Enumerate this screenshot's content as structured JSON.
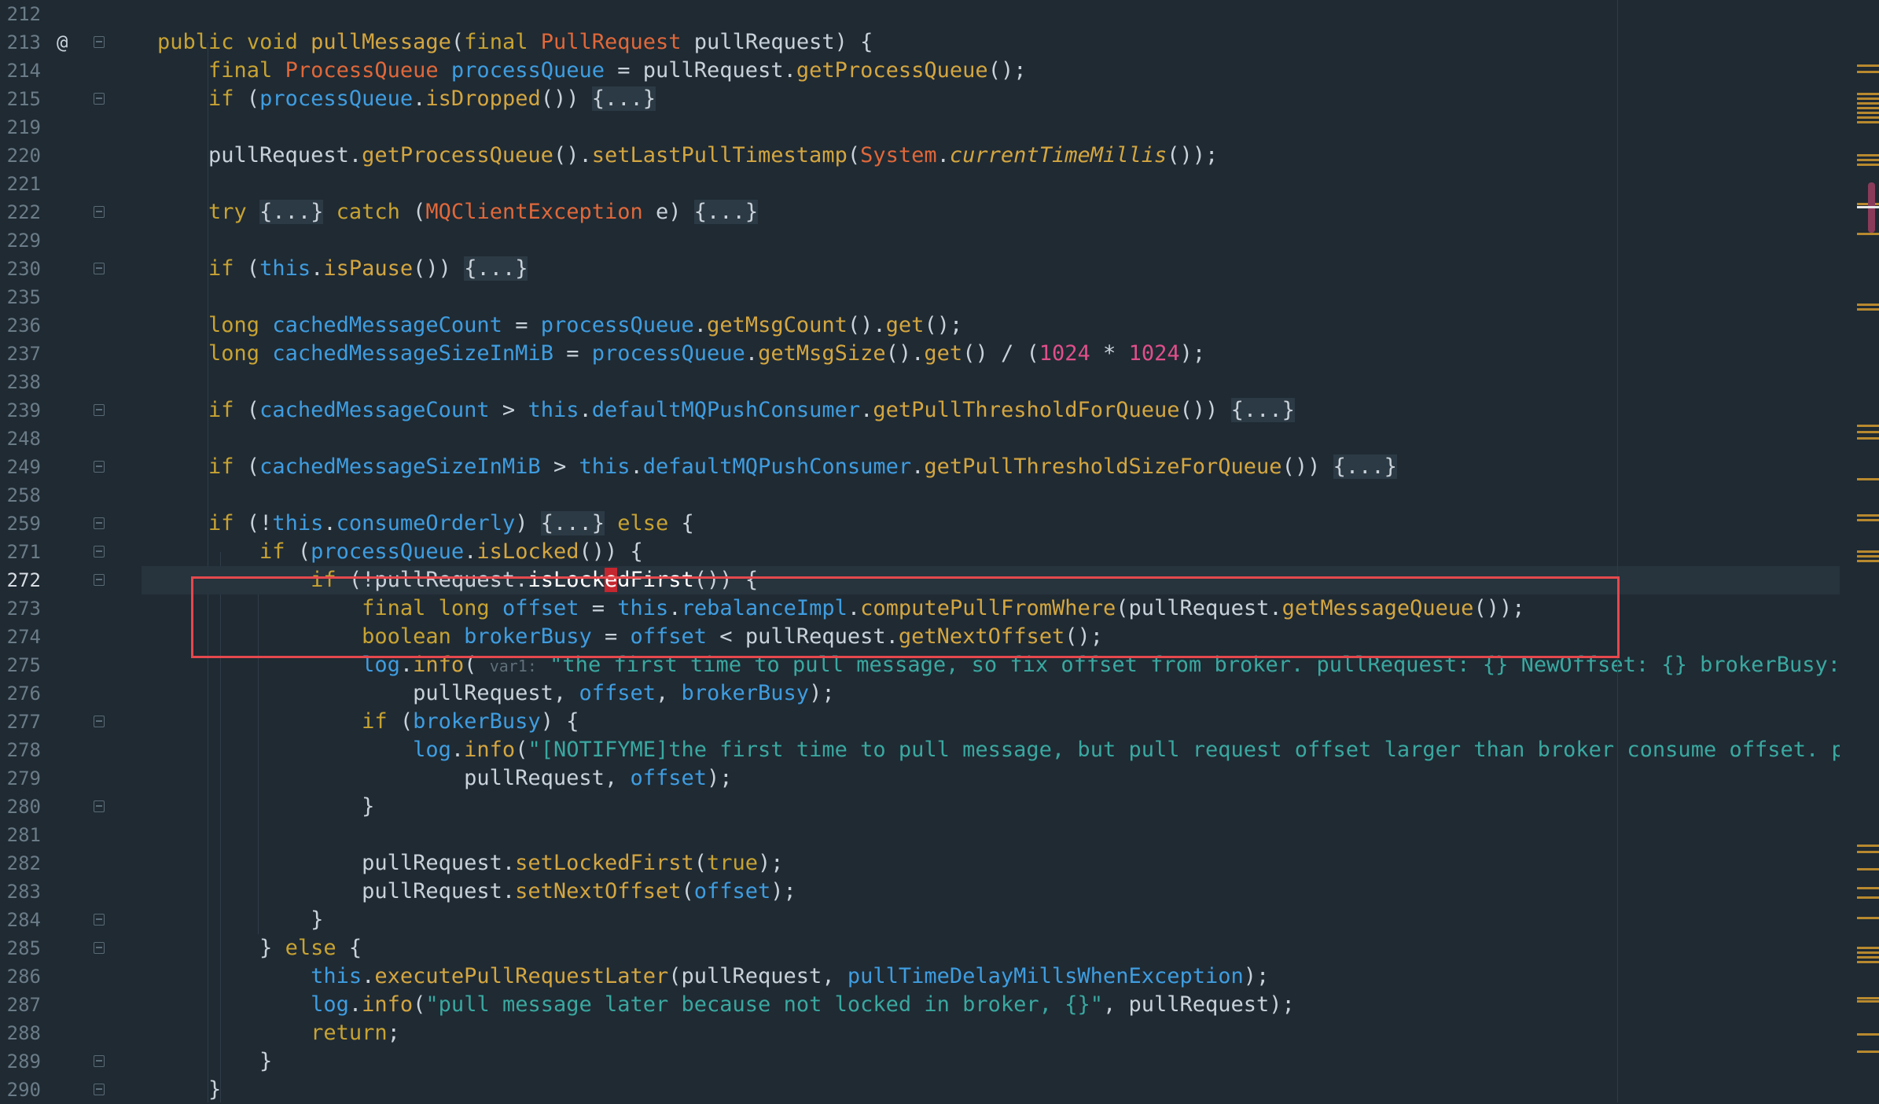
{
  "editor": {
    "colors": {
      "background": "#1f2a33",
      "keyword": "#c8a332",
      "type": "#e0683a",
      "field": "#3f9de0",
      "method": "#d4a640",
      "string": "#3aa8a0",
      "number": "#e04f8a",
      "default": "#c9d1d9",
      "fold": "#3a4a56",
      "highlight_box": "#e5484d"
    },
    "gutter_icons": {
      "override": "@"
    },
    "fold_icon_name": "fold-icon",
    "current_line": "272",
    "lines": [
      {
        "num": "212",
        "fold": false,
        "tokens": []
      },
      {
        "num": "213",
        "fold": true,
        "icon": "override",
        "tokens": [
          [
            "k",
            "public"
          ],
          [
            "d",
            " "
          ],
          [
            "k",
            "void"
          ],
          [
            "d",
            " "
          ],
          [
            "m",
            "pullMessage"
          ],
          [
            "d",
            "("
          ],
          [
            "k",
            "final"
          ],
          [
            "d",
            " "
          ],
          [
            "t",
            "PullRequest"
          ],
          [
            "d",
            " pullRequest) {"
          ]
        ]
      },
      {
        "num": "214",
        "fold": false,
        "tokens": [
          [
            "d",
            "    "
          ],
          [
            "k",
            "final"
          ],
          [
            "d",
            " "
          ],
          [
            "t",
            "ProcessQueue"
          ],
          [
            "d",
            " "
          ],
          [
            "f",
            "processQueue"
          ],
          [
            "d",
            " = pullRequest."
          ],
          [
            "m",
            "getProcessQueue"
          ],
          [
            "d",
            "();"
          ]
        ]
      },
      {
        "num": "215",
        "fold": true,
        "tokens": [
          [
            "d",
            "    "
          ],
          [
            "k",
            "if"
          ],
          [
            "d",
            " ("
          ],
          [
            "f",
            "processQueue"
          ],
          [
            "d",
            "."
          ],
          [
            "m",
            "isDropped"
          ],
          [
            "d",
            "()) "
          ],
          [
            "b",
            "{...}"
          ]
        ]
      },
      {
        "num": "219",
        "fold": false,
        "tokens": []
      },
      {
        "num": "220",
        "fold": false,
        "tokens": [
          [
            "d",
            "    pullRequest."
          ],
          [
            "m",
            "getProcessQueue"
          ],
          [
            "d",
            "()."
          ],
          [
            "m",
            "setLastPullTimestamp"
          ],
          [
            "d",
            "("
          ],
          [
            "t",
            "System"
          ],
          [
            "d",
            "."
          ],
          [
            "i",
            "currentTimeMillis"
          ],
          [
            "d",
            "());"
          ]
        ]
      },
      {
        "num": "221",
        "fold": false,
        "tokens": []
      },
      {
        "num": "222",
        "fold": true,
        "tokens": [
          [
            "d",
            "    "
          ],
          [
            "k",
            "try"
          ],
          [
            "d",
            " "
          ],
          [
            "b",
            "{...}"
          ],
          [
            "d",
            " "
          ],
          [
            "k",
            "catch"
          ],
          [
            "d",
            " ("
          ],
          [
            "t",
            "MQClientException"
          ],
          [
            "d",
            " e) "
          ],
          [
            "b",
            "{...}"
          ]
        ]
      },
      {
        "num": "229",
        "fold": false,
        "tokens": []
      },
      {
        "num": "230",
        "fold": true,
        "tokens": [
          [
            "d",
            "    "
          ],
          [
            "k",
            "if"
          ],
          [
            "d",
            " ("
          ],
          [
            "f",
            "this"
          ],
          [
            "d",
            "."
          ],
          [
            "m",
            "isPause"
          ],
          [
            "d",
            "()) "
          ],
          [
            "b",
            "{...}"
          ]
        ]
      },
      {
        "num": "235",
        "fold": false,
        "tokens": []
      },
      {
        "num": "236",
        "fold": false,
        "tokens": [
          [
            "d",
            "    "
          ],
          [
            "k",
            "long"
          ],
          [
            "d",
            " "
          ],
          [
            "f",
            "cachedMessageCount"
          ],
          [
            "d",
            " = "
          ],
          [
            "f",
            "processQueue"
          ],
          [
            "d",
            "."
          ],
          [
            "m",
            "getMsgCount"
          ],
          [
            "d",
            "()."
          ],
          [
            "m",
            "get"
          ],
          [
            "d",
            "();"
          ]
        ]
      },
      {
        "num": "237",
        "fold": false,
        "tokens": [
          [
            "d",
            "    "
          ],
          [
            "k",
            "long"
          ],
          [
            "d",
            " "
          ],
          [
            "f",
            "cachedMessageSizeInMiB"
          ],
          [
            "d",
            " = "
          ],
          [
            "f",
            "processQueue"
          ],
          [
            "d",
            "."
          ],
          [
            "m",
            "getMsgSize"
          ],
          [
            "d",
            "()."
          ],
          [
            "m",
            "get"
          ],
          [
            "d",
            "() / ("
          ],
          [
            "n",
            "1024"
          ],
          [
            "d",
            " * "
          ],
          [
            "n",
            "1024"
          ],
          [
            "d",
            ");"
          ]
        ]
      },
      {
        "num": "238",
        "fold": false,
        "tokens": []
      },
      {
        "num": "239",
        "fold": true,
        "tokens": [
          [
            "d",
            "    "
          ],
          [
            "k",
            "if"
          ],
          [
            "d",
            " ("
          ],
          [
            "f",
            "cachedMessageCount"
          ],
          [
            "d",
            " > "
          ],
          [
            "f",
            "this"
          ],
          [
            "d",
            "."
          ],
          [
            "f",
            "defaultMQPushConsumer"
          ],
          [
            "d",
            "."
          ],
          [
            "m",
            "getPullThresholdForQueue"
          ],
          [
            "d",
            "()) "
          ],
          [
            "b",
            "{...}"
          ]
        ]
      },
      {
        "num": "248",
        "fold": false,
        "tokens": []
      },
      {
        "num": "249",
        "fold": true,
        "tokens": [
          [
            "d",
            "    "
          ],
          [
            "k",
            "if"
          ],
          [
            "d",
            " ("
          ],
          [
            "f",
            "cachedMessageSizeInMiB"
          ],
          [
            "d",
            " > "
          ],
          [
            "f",
            "this"
          ],
          [
            "d",
            "."
          ],
          [
            "f",
            "defaultMQPushConsumer"
          ],
          [
            "d",
            "."
          ],
          [
            "m",
            "getPullThresholdSizeForQueue"
          ],
          [
            "d",
            "()) "
          ],
          [
            "b",
            "{...}"
          ]
        ]
      },
      {
        "num": "258",
        "fold": false,
        "tokens": []
      },
      {
        "num": "259",
        "fold": true,
        "tokens": [
          [
            "d",
            "    "
          ],
          [
            "k",
            "if"
          ],
          [
            "d",
            " (!"
          ],
          [
            "f",
            "this"
          ],
          [
            "d",
            "."
          ],
          [
            "f",
            "consumeOrderly"
          ],
          [
            "d",
            ") "
          ],
          [
            "b",
            "{...}"
          ],
          [
            "d",
            " "
          ],
          [
            "k",
            "else"
          ],
          [
            "d",
            " {"
          ]
        ]
      },
      {
        "num": "271",
        "fold": true,
        "tokens": [
          [
            "d",
            "        "
          ],
          [
            "k",
            "if"
          ],
          [
            "d",
            " ("
          ],
          [
            "f",
            "processQueue"
          ],
          [
            "d",
            "."
          ],
          [
            "m",
            "isLocked"
          ],
          [
            "d",
            "()) {"
          ]
        ]
      },
      {
        "num": "272",
        "fold": true,
        "tokens": [
          [
            "d",
            "            "
          ],
          [
            "k",
            "if"
          ],
          [
            "d",
            " (!pullRequest."
          ],
          [
            "w",
            "isLock"
          ],
          [
            "r",
            "e"
          ],
          [
            "w",
            "dFirst"
          ],
          [
            "d",
            "()) {"
          ]
        ]
      },
      {
        "num": "273",
        "fold": false,
        "tokens": [
          [
            "d",
            "                "
          ],
          [
            "k",
            "final"
          ],
          [
            "d",
            " "
          ],
          [
            "k",
            "long"
          ],
          [
            "d",
            " "
          ],
          [
            "f",
            "offset"
          ],
          [
            "d",
            " = "
          ],
          [
            "f",
            "this"
          ],
          [
            "d",
            "."
          ],
          [
            "f",
            "rebalanceImpl"
          ],
          [
            "d",
            "."
          ],
          [
            "m",
            "computePullFromWhere"
          ],
          [
            "d",
            "(pullRequest."
          ],
          [
            "m",
            "getMessageQueue"
          ],
          [
            "d",
            "());"
          ]
        ]
      },
      {
        "num": "274",
        "fold": false,
        "tokens": [
          [
            "d",
            "                "
          ],
          [
            "k",
            "boolean"
          ],
          [
            "d",
            " "
          ],
          [
            "f",
            "brokerBusy"
          ],
          [
            "d",
            " = "
          ],
          [
            "f",
            "offset"
          ],
          [
            "d",
            " < pullRequest."
          ],
          [
            "m",
            "getNextOffset"
          ],
          [
            "d",
            "();"
          ]
        ]
      },
      {
        "num": "275",
        "fold": false,
        "tokens": [
          [
            "d",
            "                "
          ],
          [
            "f",
            "log"
          ],
          [
            "d",
            "."
          ],
          [
            "m",
            "info"
          ],
          [
            "d",
            "( "
          ],
          [
            "h",
            "var1:"
          ],
          [
            "d",
            " "
          ],
          [
            "s",
            "\"the first time to pull message, so fix offset from broker. pullRequest: {} NewOffset: {} brokerBusy: {}\""
          ],
          [
            "d",
            ","
          ]
        ]
      },
      {
        "num": "276",
        "fold": false,
        "tokens": [
          [
            "d",
            "                    pullRequest, "
          ],
          [
            "f",
            "offset"
          ],
          [
            "d",
            ", "
          ],
          [
            "f",
            "brokerBusy"
          ],
          [
            "d",
            ");"
          ]
        ]
      },
      {
        "num": "277",
        "fold": true,
        "tokens": [
          [
            "d",
            "                "
          ],
          [
            "k",
            "if"
          ],
          [
            "d",
            " ("
          ],
          [
            "f",
            "brokerBusy"
          ],
          [
            "d",
            ") {"
          ]
        ]
      },
      {
        "num": "278",
        "fold": false,
        "tokens": [
          [
            "d",
            "                    "
          ],
          [
            "f",
            "log"
          ],
          [
            "d",
            "."
          ],
          [
            "m",
            "info"
          ],
          [
            "d",
            "("
          ],
          [
            "s",
            "\"[NOTIFYME]the first time to pull message, but pull request offset larger than broker consume offset. pullRe"
          ]
        ]
      },
      {
        "num": "279",
        "fold": false,
        "tokens": [
          [
            "d",
            "                        pullRequest, "
          ],
          [
            "f",
            "offset"
          ],
          [
            "d",
            ");"
          ]
        ]
      },
      {
        "num": "280",
        "fold": true,
        "tokens": [
          [
            "d",
            "                }"
          ]
        ]
      },
      {
        "num": "281",
        "fold": false,
        "tokens": []
      },
      {
        "num": "282",
        "fold": false,
        "tokens": [
          [
            "d",
            "                pullRequest."
          ],
          [
            "m",
            "setLockedFirst"
          ],
          [
            "d",
            "("
          ],
          [
            "k",
            "true"
          ],
          [
            "d",
            ");"
          ]
        ]
      },
      {
        "num": "283",
        "fold": false,
        "tokens": [
          [
            "d",
            "                pullRequest."
          ],
          [
            "m",
            "setNextOffset"
          ],
          [
            "d",
            "("
          ],
          [
            "f",
            "offset"
          ],
          [
            "d",
            ");"
          ]
        ]
      },
      {
        "num": "284",
        "fold": true,
        "tokens": [
          [
            "d",
            "            }"
          ]
        ]
      },
      {
        "num": "285",
        "fold": true,
        "tokens": [
          [
            "d",
            "        } "
          ],
          [
            "k",
            "else"
          ],
          [
            "d",
            " {"
          ]
        ]
      },
      {
        "num": "286",
        "fold": false,
        "tokens": [
          [
            "d",
            "            "
          ],
          [
            "f",
            "this"
          ],
          [
            "d",
            "."
          ],
          [
            "m",
            "executePullRequestLater"
          ],
          [
            "d",
            "(pullRequest, "
          ],
          [
            "f",
            "pullTimeDelayMillsWhenException"
          ],
          [
            "d",
            ");"
          ]
        ]
      },
      {
        "num": "287",
        "fold": false,
        "tokens": [
          [
            "d",
            "            "
          ],
          [
            "f",
            "log"
          ],
          [
            "d",
            "."
          ],
          [
            "m",
            "info"
          ],
          [
            "d",
            "("
          ],
          [
            "s",
            "\"pull message later because not locked in broker, {}\""
          ],
          [
            "d",
            ", pullRequest);"
          ]
        ]
      },
      {
        "num": "288",
        "fold": false,
        "tokens": [
          [
            "d",
            "            "
          ],
          [
            "k",
            "return"
          ],
          [
            "d",
            ";"
          ]
        ]
      },
      {
        "num": "289",
        "fold": true,
        "tokens": [
          [
            "d",
            "        }"
          ]
        ]
      },
      {
        "num": "290",
        "fold": true,
        "tokens": [
          [
            "d",
            "    }"
          ]
        ]
      }
    ]
  }
}
